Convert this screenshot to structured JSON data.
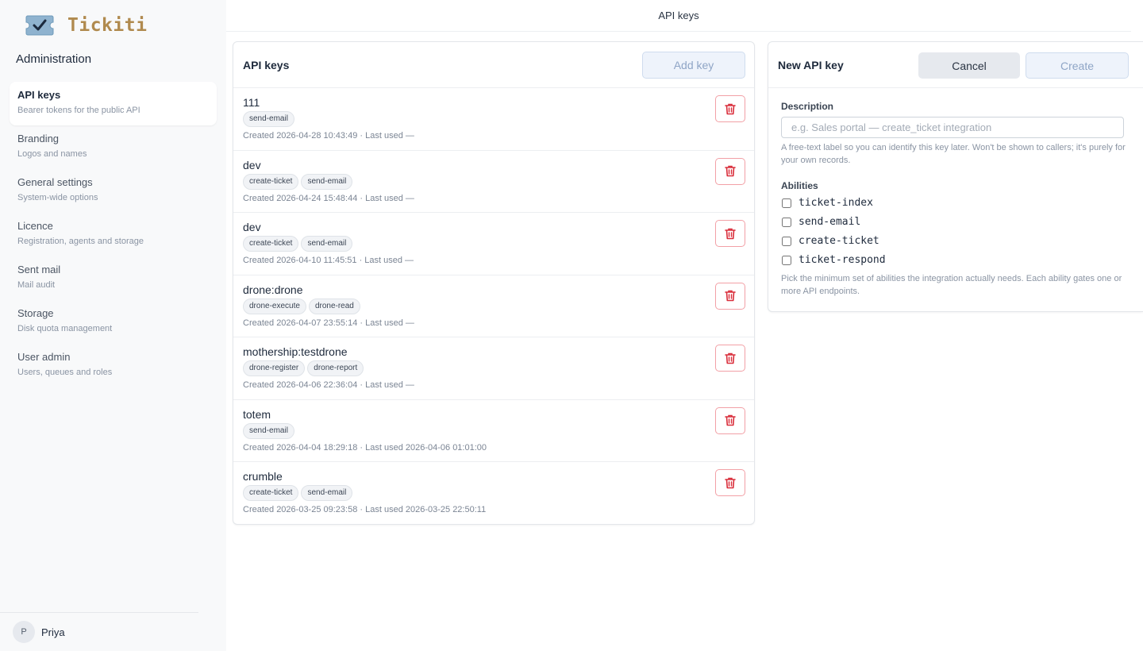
{
  "app": {
    "name": "Tickiti",
    "section_title": "Administration"
  },
  "header": {
    "title": "API keys"
  },
  "sidebar": {
    "items": [
      {
        "label": "API keys",
        "sub": "Bearer tokens for the public API"
      },
      {
        "label": "Branding",
        "sub": "Logos and names"
      },
      {
        "label": "General settings",
        "sub": "System-wide options"
      },
      {
        "label": "Licence",
        "sub": "Registration, agents and storage"
      },
      {
        "label": "Sent mail",
        "sub": "Mail audit"
      },
      {
        "label": "Storage",
        "sub": "Disk quota management"
      },
      {
        "label": "User admin",
        "sub": "Users, queues and roles"
      }
    ],
    "user": {
      "initial": "P",
      "name": "Priya"
    }
  },
  "keys_panel": {
    "title": "API keys",
    "add_label": "Add key",
    "keys": [
      {
        "name": "111",
        "tags": [
          "send-email"
        ],
        "meta": "Created 2026-04-28 10:43:49 · Last used —"
      },
      {
        "name": "dev",
        "tags": [
          "create-ticket",
          "send-email"
        ],
        "meta": "Created 2026-04-24 15:48:44 · Last used —"
      },
      {
        "name": "dev",
        "tags": [
          "create-ticket",
          "send-email"
        ],
        "meta": "Created 2026-04-10 11:45:51 · Last used —"
      },
      {
        "name": "drone:drone",
        "tags": [
          "drone-execute",
          "drone-read"
        ],
        "meta": "Created 2026-04-07 23:55:14 · Last used —"
      },
      {
        "name": "mothership:testdrone",
        "tags": [
          "drone-register",
          "drone-report"
        ],
        "meta": "Created 2026-04-06 22:36:04 · Last used —"
      },
      {
        "name": "totem",
        "tags": [
          "send-email"
        ],
        "meta": "Created 2026-04-04 18:29:18 · Last used 2026-04-06 01:01:00"
      },
      {
        "name": "crumble",
        "tags": [
          "create-ticket",
          "send-email"
        ],
        "meta": "Created 2026-03-25 09:23:58 · Last used 2026-03-25 22:50:11"
      }
    ]
  },
  "new_key": {
    "title": "New API key",
    "cancel_label": "Cancel",
    "create_label": "Create",
    "description_label": "Description",
    "description_value": "",
    "description_placeholder": "e.g. Sales portal — create_ticket integration",
    "description_help": "A free-text label so you can identify this key later. Won't be shown to callers; it's purely for your own records.",
    "abilities_label": "Abilities",
    "abilities": [
      {
        "name": "ticket-index",
        "checked": false
      },
      {
        "name": "send-email",
        "checked": false
      },
      {
        "name": "create-ticket",
        "checked": false
      },
      {
        "name": "ticket-respond",
        "checked": false
      }
    ],
    "abilities_help": "Pick the minimum set of abilities the integration actually needs. Each ability gates one or more API endpoints."
  },
  "icons": {
    "delete": "trash-icon",
    "logo": "ticket-check-icon"
  },
  "colors": {
    "accent": "#b08a4e",
    "danger": "#d92d3a",
    "primary_disabled": "#8fa5c6"
  }
}
